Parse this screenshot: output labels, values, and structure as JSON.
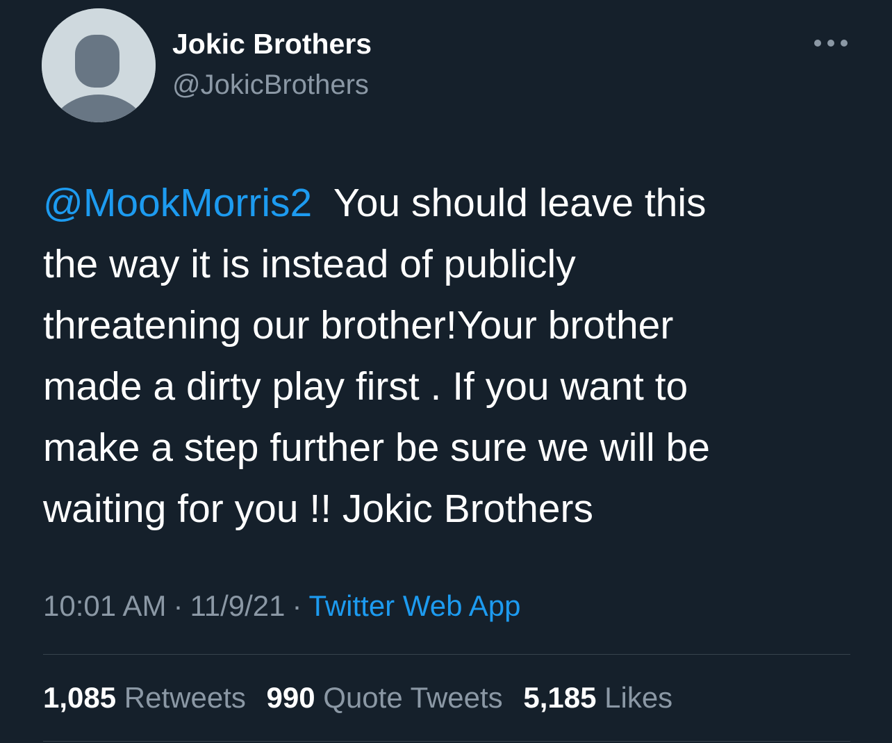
{
  "author": {
    "display_name": "Jokic Brothers",
    "handle": "@JokicBrothers",
    "avatar_icon": "default-avatar-icon"
  },
  "more_icon": "more-horizontal-icon",
  "tweet": {
    "mention": "@MookMorris2",
    "text_lines": [
      "You should leave this",
      "the way it is instead of publicly",
      "threatening our brother!Your brother",
      "made a dirty play first . If you want to",
      "make a step further be sure we will be",
      "waiting for you !! Jokic Brothers"
    ]
  },
  "meta": {
    "time": "10:01 AM",
    "separator": "·",
    "date": "11/9/21",
    "source": "Twitter Web App"
  },
  "stats": {
    "retweets_count": "1,085",
    "retweets_label": "Retweets",
    "quotes_count": "990",
    "quotes_label": "Quote Tweets",
    "likes_count": "5,185",
    "likes_label": "Likes"
  },
  "colors": {
    "background": "#15202b",
    "accent": "#1d9bf0",
    "secondary_text": "#8b98a5",
    "divider": "#38444d"
  }
}
